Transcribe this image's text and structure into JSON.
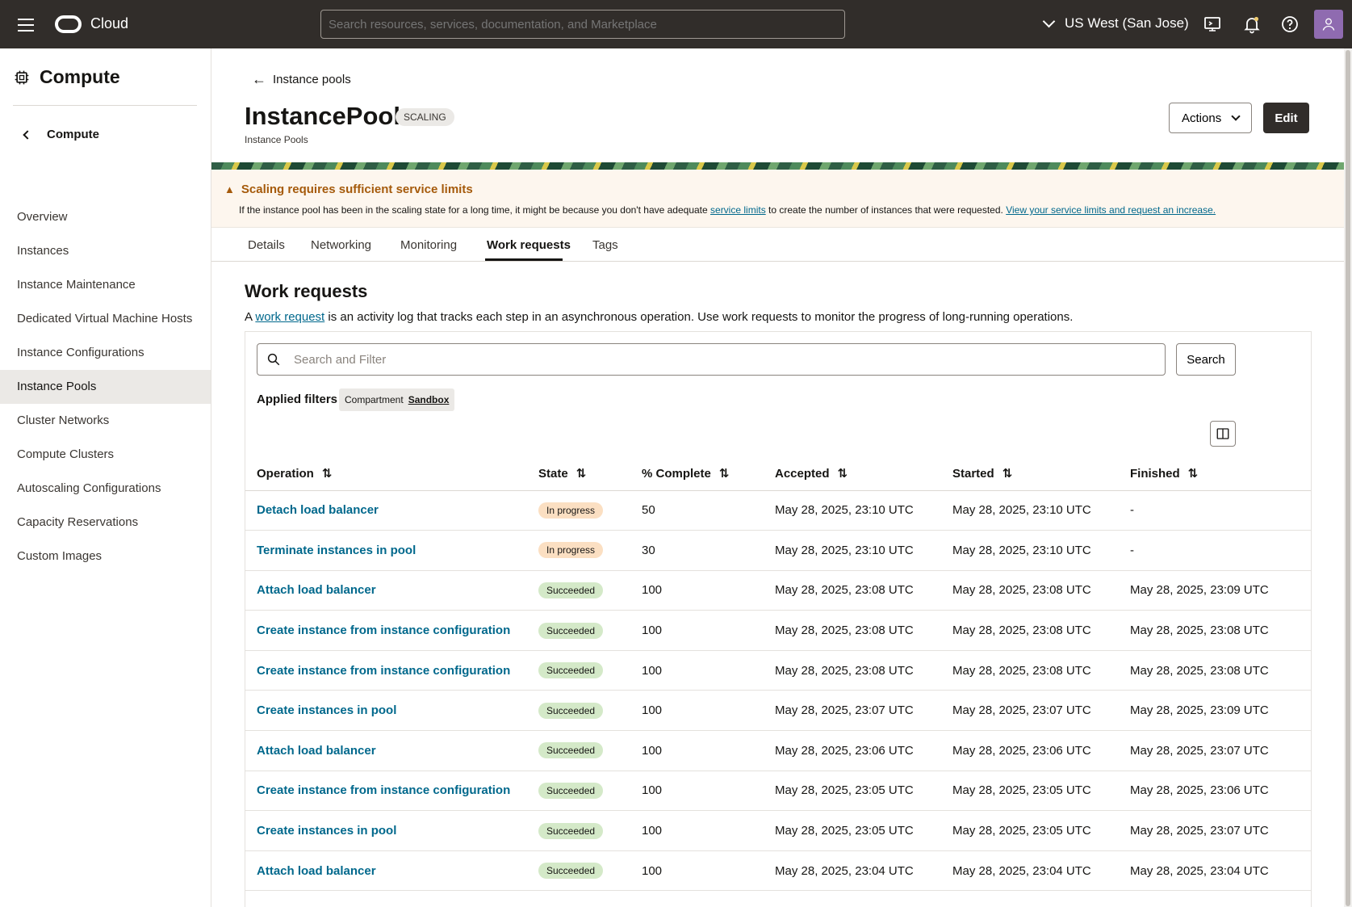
{
  "topbar": {
    "brand": "Cloud",
    "search_placeholder": "Search resources, services, documentation, and Marketplace",
    "region": "US West (San Jose)"
  },
  "sidebar": {
    "title": "Compute",
    "back_label": "Compute",
    "items": [
      {
        "label": "Overview"
      },
      {
        "label": "Instances"
      },
      {
        "label": "Instance Maintenance"
      },
      {
        "label": "Dedicated Virtual Machine Hosts"
      },
      {
        "label": "Instance Configurations"
      },
      {
        "label": "Instance Pools",
        "active": true
      },
      {
        "label": "Cluster Networks"
      },
      {
        "label": "Compute Clusters"
      },
      {
        "label": "Autoscaling Configurations"
      },
      {
        "label": "Capacity Reservations"
      },
      {
        "label": "Custom Images"
      }
    ]
  },
  "header": {
    "back_label": "Instance pools",
    "title": "InstancePool",
    "status_badge": "SCALING",
    "subtitle": "Instance Pools",
    "actions_label": "Actions",
    "edit_label": "Edit"
  },
  "warning": {
    "title": "Scaling requires sufficient service limits",
    "body_prefix": "If the instance pool has been in the scaling state for a long time, it might be because you don't have adequate ",
    "link1": "service limits",
    "body_middle": " to create the number of instances that were requested. ",
    "link2": "View your service limits and request an increase."
  },
  "tabs": [
    {
      "label": "Details"
    },
    {
      "label": "Networking"
    },
    {
      "label": "Monitoring"
    },
    {
      "label": "Work requests",
      "active": true
    },
    {
      "label": "Tags"
    }
  ],
  "work_requests": {
    "title": "Work requests",
    "intro_prefix": "A ",
    "intro_link": "work request",
    "intro_suffix": " is an activity log that tracks each step in an asynchronous operation. Use work requests to monitor the progress of long-running operations.",
    "filter_placeholder": "Search and Filter",
    "search_button": "Search",
    "applied_filters_label": "Applied filters",
    "chip_label": "Compartment",
    "chip_value": "Sandbox",
    "columns": [
      "Operation",
      "State",
      "% Complete",
      "Accepted",
      "Started",
      "Finished"
    ],
    "rows": [
      {
        "operation": "Detach load balancer",
        "state": "In progress",
        "complete": "50",
        "accepted": "May 28, 2025, 23:10 UTC",
        "started": "May 28, 2025, 23:10 UTC",
        "finished": "-"
      },
      {
        "operation": "Terminate instances in pool",
        "state": "In progress",
        "complete": "30",
        "accepted": "May 28, 2025, 23:10 UTC",
        "started": "May 28, 2025, 23:10 UTC",
        "finished": "-"
      },
      {
        "operation": "Attach load balancer",
        "state": "Succeeded",
        "complete": "100",
        "accepted": "May 28, 2025, 23:08 UTC",
        "started": "May 28, 2025, 23:08 UTC",
        "finished": "May 28, 2025, 23:09 UTC"
      },
      {
        "operation": "Create instance from instance configuration",
        "state": "Succeeded",
        "complete": "100",
        "accepted": "May 28, 2025, 23:08 UTC",
        "started": "May 28, 2025, 23:08 UTC",
        "finished": "May 28, 2025, 23:08 UTC"
      },
      {
        "operation": "Create instance from instance configuration",
        "state": "Succeeded",
        "complete": "100",
        "accepted": "May 28, 2025, 23:08 UTC",
        "started": "May 28, 2025, 23:08 UTC",
        "finished": "May 28, 2025, 23:08 UTC"
      },
      {
        "operation": "Create instances in pool",
        "state": "Succeeded",
        "complete": "100",
        "accepted": "May 28, 2025, 23:07 UTC",
        "started": "May 28, 2025, 23:07 UTC",
        "finished": "May 28, 2025, 23:09 UTC"
      },
      {
        "operation": "Attach load balancer",
        "state": "Succeeded",
        "complete": "100",
        "accepted": "May 28, 2025, 23:06 UTC",
        "started": "May 28, 2025, 23:06 UTC",
        "finished": "May 28, 2025, 23:07 UTC"
      },
      {
        "operation": "Create instance from instance configuration",
        "state": "Succeeded",
        "complete": "100",
        "accepted": "May 28, 2025, 23:05 UTC",
        "started": "May 28, 2025, 23:05 UTC",
        "finished": "May 28, 2025, 23:06 UTC"
      },
      {
        "operation": "Create instances in pool",
        "state": "Succeeded",
        "complete": "100",
        "accepted": "May 28, 2025, 23:05 UTC",
        "started": "May 28, 2025, 23:05 UTC",
        "finished": "May 28, 2025, 23:07 UTC"
      },
      {
        "operation": "Attach load balancer",
        "state": "Succeeded",
        "complete": "100",
        "accepted": "May 28, 2025, 23:04 UTC",
        "started": "May 28, 2025, 23:04 UTC",
        "finished": "May 28, 2025, 23:04 UTC"
      }
    ]
  },
  "icons": {
    "menu": "hamburger-menu-icon",
    "logo": "cloud-logo-icon",
    "region_chevron": "chevron-down-icon",
    "cloud_shell": "cloud-shell-icon",
    "notifications": "bell-icon",
    "help": "help-icon",
    "user": "user-avatar-icon",
    "warning": "warning-triangle-icon",
    "search": "search-icon",
    "columns": "column-settings-icon",
    "sort": "sort-icon"
  },
  "colors": {
    "topbar": "#312d2a",
    "link": "#00688c",
    "warning_text": "#a55a0b",
    "in_progress_badge": "#fbdfc2",
    "succeeded_badge": "#d4e9c8",
    "avatar": "#8f6bb0"
  }
}
